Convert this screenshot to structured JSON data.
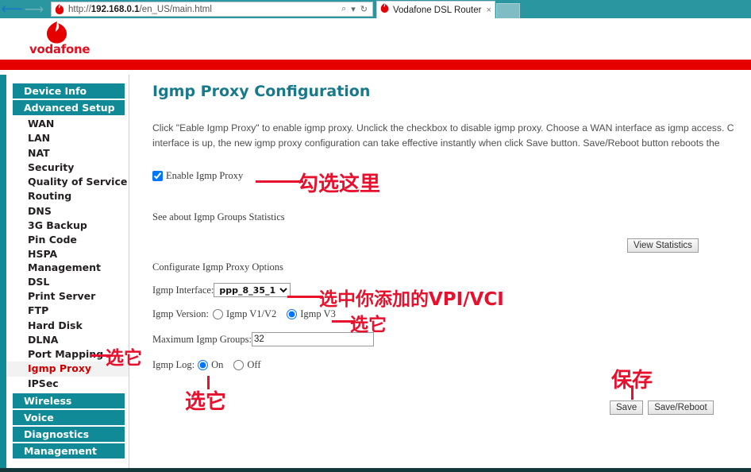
{
  "browser": {
    "back_icon": "back-arrow-icon",
    "forward_icon": "forward-arrow-icon",
    "url_prefix": "http://",
    "url_host": "192.168.0.1",
    "url_path": "/en_US/main.html",
    "url_full": "http://192.168.0.1/en_US/main.html",
    "search_icon": "search-icon",
    "dropdown_icon": "chevron-down-icon",
    "refresh_icon": "refresh-icon",
    "tab_title": "Vodafone DSL Router",
    "tab_close": "×",
    "chrome_color": "#2a96a0"
  },
  "header": {
    "brand": "vodafone",
    "brand_color": "#e60000",
    "bar_color": "#e60000"
  },
  "sidebar": {
    "accent_color": "#0f8a96",
    "active_color": "#cc0000",
    "groups": [
      {
        "type": "head",
        "label": "Device Info"
      },
      {
        "type": "head",
        "label": "Advanced Setup"
      }
    ],
    "items": [
      {
        "label": "WAN",
        "active": false
      },
      {
        "label": "LAN",
        "active": false
      },
      {
        "label": "NAT",
        "active": false
      },
      {
        "label": "Security",
        "active": false
      },
      {
        "label": "Quality of Service",
        "active": false
      },
      {
        "label": "Routing",
        "active": false
      },
      {
        "label": "DNS",
        "active": false
      },
      {
        "label": "3G Backup",
        "active": false
      },
      {
        "label": "Pin Code",
        "active": false
      },
      {
        "label": "HSPA Management",
        "active": false
      },
      {
        "label": "DSL",
        "active": false
      },
      {
        "label": "Print Server",
        "active": false
      },
      {
        "label": "FTP",
        "active": false
      },
      {
        "label": "Hard Disk",
        "active": false
      },
      {
        "label": "DLNA",
        "active": false
      },
      {
        "label": "Port Mapping",
        "active": false
      },
      {
        "label": "Igmp Proxy",
        "active": true
      },
      {
        "label": "IPSec",
        "active": false
      }
    ],
    "tail_heads": [
      {
        "label": "Wireless"
      },
      {
        "label": "Voice"
      },
      {
        "label": "Diagnostics"
      },
      {
        "label": "Management"
      }
    ]
  },
  "main": {
    "title": "Igmp Proxy Configuration",
    "title_color": "#17798a",
    "intro_line1": "Click \"Eable Igmp Proxy\" to enable igmp proxy.  Unclick the checkbox to disable igmp proxy.  Choose a WAN interface as igmp access.  C",
    "intro_line2": "interface is up,  the new igmp proxy configuration can take effective instantly when click Save button.  Save/Reboot button reboots the",
    "enable_label": "Enable Igmp Proxy",
    "enable_checked": true,
    "see_stats_label": "See about Igmp Groups Statistics",
    "view_stats_button": "View Statistics",
    "configure_label": "Configurate Igmp Proxy Options",
    "iface_label": "Igmp Interface:",
    "iface_value": "ppp_8_35_1",
    "iface_options": [
      "ppp_8_35_1"
    ],
    "version_label": "Igmp Version:",
    "version_v1v2": "Igmp V1/V2",
    "version_v3": "Igmp V3",
    "version_selected": "Igmp V3",
    "maxgroups_label": "Maximum Igmp Groups:",
    "maxgroups_value": "32",
    "log_label": "Igmp Log:",
    "log_on": "On",
    "log_off": "Off",
    "log_selected": "On",
    "save_button": "Save",
    "save_reboot_button": "Save/Reboot"
  },
  "annotations": {
    "color": "#e8112d",
    "enable": "勾选这里",
    "sidebar": "选它",
    "iface": "选中你添加的VPI/VCI",
    "version": "选它",
    "log": "选它",
    "save": "保存"
  }
}
